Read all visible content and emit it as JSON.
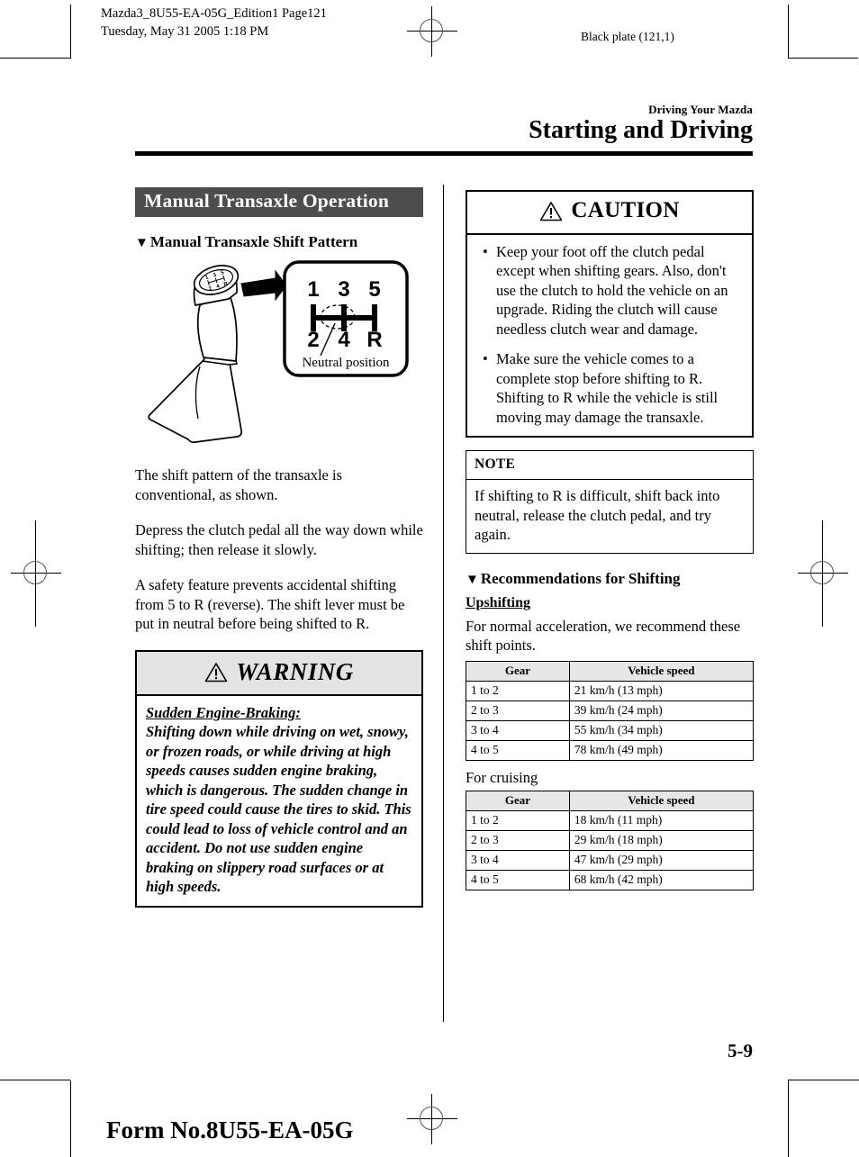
{
  "print_marks": {
    "job_meta_line1": "Mazda3_8U55-EA-05G_Edition1 Page121",
    "job_meta_line2": "Tuesday, May 31 2005 1:18 PM",
    "plate_label": "Black plate (121,1)"
  },
  "header": {
    "eyebrow": "Driving Your Mazda",
    "chapter_title": "Starting and Driving"
  },
  "left_column": {
    "band_heading": "Manual Transaxle Operation",
    "subsection_heading": "Manual Transaxle Shift Pattern",
    "triangle_glyph": "▼",
    "figure": {
      "name": "manual-transaxle-shift-pattern-diagram",
      "gear_top": [
        "1",
        "3",
        "5"
      ],
      "gear_bottom": [
        "2",
        "4",
        "R"
      ],
      "callout_label": "Neutral position",
      "knob_label_top": "1 3 5",
      "knob_label_bottom": "2 4 R"
    },
    "paragraphs": [
      "The shift pattern of the transaxle is conventional, as shown.",
      "Depress the clutch pedal all the way down while shifting; then release it slowly.",
      "A safety feature prevents accidental shifting from 5 to R (reverse). The shift lever must be put in neutral before being shifted to R."
    ],
    "warning_box": {
      "title": "WARNING",
      "icon": "warning-triangle-icon",
      "lead": "Sudden Engine-Braking:",
      "body": "Shifting down while driving on wet, snowy, or frozen roads, or while driving at high speeds causes sudden engine braking, which is dangerous. The sudden change in tire speed could cause the tires to skid. This could lead to loss of vehicle control and an accident. Do not use sudden engine braking on slippery road surfaces or at high speeds."
    }
  },
  "right_column": {
    "caution_box": {
      "title": "CAUTION",
      "icon": "warning-triangle-icon",
      "bullet_glyph": "•",
      "items": [
        "Keep your foot off the clutch pedal except when shifting gears. Also, don't use the clutch to hold the vehicle on an upgrade. Riding the clutch will cause needless clutch wear and damage.",
        "Make sure the vehicle comes to a complete stop before shifting to R. Shifting to R while the vehicle is still moving may damage the transaxle."
      ]
    },
    "note_box": {
      "title": "NOTE",
      "body": "If shifting to R is difficult, shift back into neutral, release the clutch pedal, and try again."
    },
    "recommendations_heading": "Recommendations for Shifting",
    "triangle_glyph": "▼",
    "upshifting_heading": "Upshifting",
    "upshifting_intro": "For normal acceleration, we recommend these shift points.",
    "table_upshifting": {
      "name": "upshifting-shift-points-table",
      "columns": [
        "Gear",
        "Vehicle speed"
      ],
      "rows": [
        [
          "1 to 2",
          "21 km/h (13 mph)"
        ],
        [
          "2 to 3",
          "39 km/h (24 mph)"
        ],
        [
          "3 to 4",
          "55 km/h (34 mph)"
        ],
        [
          "4 to 5",
          "78 km/h (49 mph)"
        ]
      ]
    },
    "cruising_caption": "For cruising",
    "table_cruising": {
      "name": "cruising-shift-points-table",
      "columns": [
        "Gear",
        "Vehicle speed"
      ],
      "rows": [
        [
          "1 to 2",
          "18 km/h (11 mph)"
        ],
        [
          "2 to 3",
          "29 km/h (18 mph)"
        ],
        [
          "3 to 4",
          "47 km/h (29 mph)"
        ],
        [
          "4 to 5",
          "68 km/h (42 mph)"
        ]
      ]
    }
  },
  "footer": {
    "page_number": "5-9",
    "form_number": "Form No.8U55-EA-05G"
  },
  "colors": {
    "band_heading_bg": "#4d4d4d",
    "band_heading_text": "#ffffff",
    "warning_head_bg": "#e3e3e3",
    "table_header_bg": "#e6e6e6",
    "rule": "#000000"
  }
}
